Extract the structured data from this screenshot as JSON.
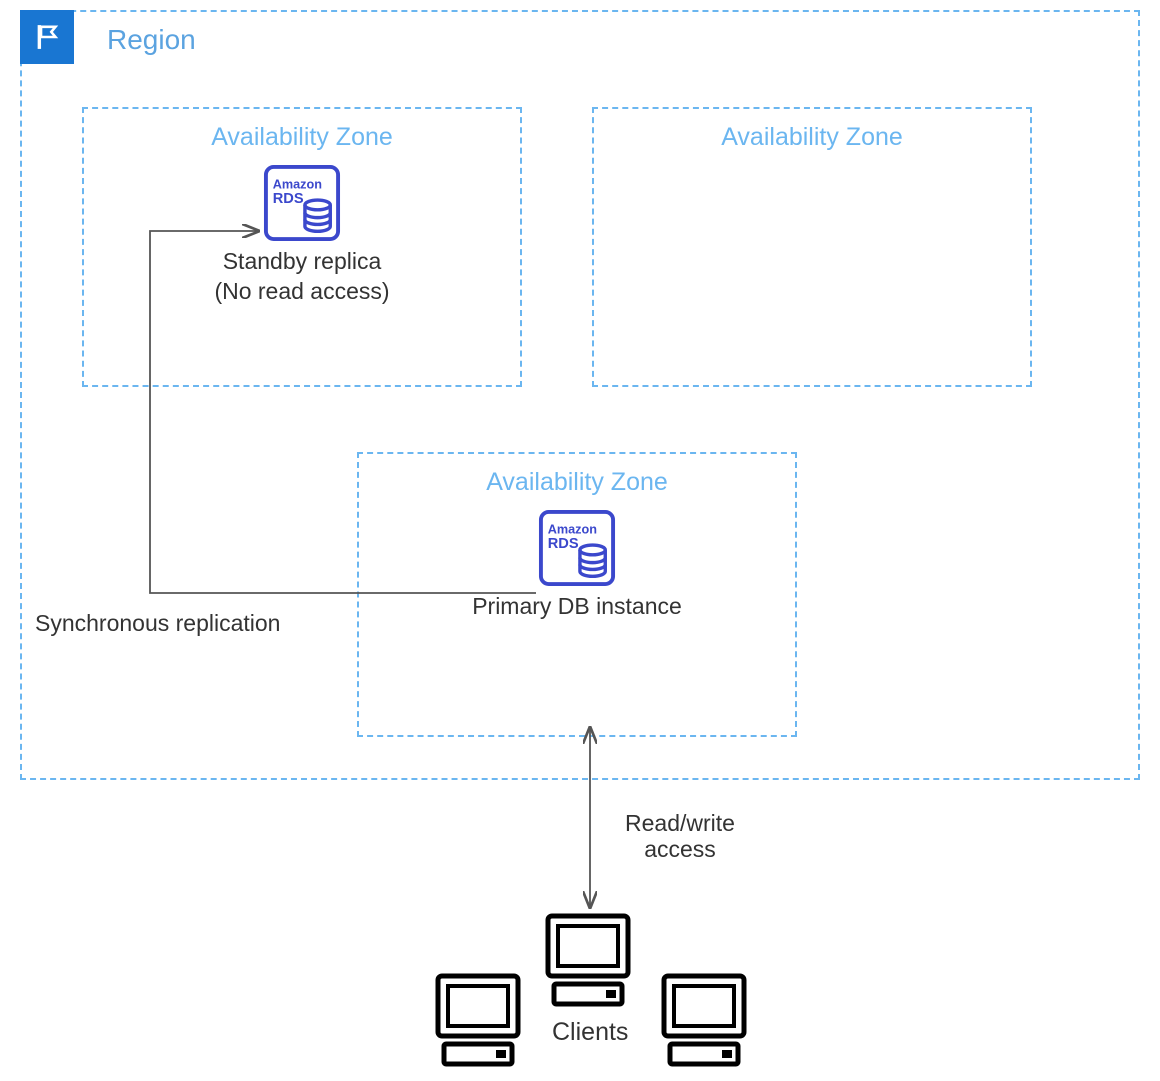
{
  "region": {
    "title": "Region"
  },
  "az1": {
    "title": "Availability Zone",
    "node_label_line1": "Standby replica",
    "node_label_line2": "(No read access)",
    "rds_label_line1": "Amazon",
    "rds_label_line2": "RDS"
  },
  "az2": {
    "title": "Availability Zone"
  },
  "az3": {
    "title": "Availability Zone",
    "node_label": "Primary DB instance",
    "rds_label_line1": "Amazon",
    "rds_label_line2": "RDS"
  },
  "labels": {
    "replication": "Synchronous replication",
    "access_line1": "Read/write",
    "access_line2": "access",
    "clients": "Clients"
  },
  "icons": {
    "region_flag": "region-flag-icon",
    "rds": "amazon-rds-icon",
    "client": "client-computer-icon"
  },
  "colors": {
    "dash_border": "#6bb6f0",
    "az_text": "#6bb6f0",
    "region_text": "#5ba3e0",
    "flag_bg": "#1976d2",
    "rds_color": "#3b48cc",
    "body_text": "#333333"
  }
}
